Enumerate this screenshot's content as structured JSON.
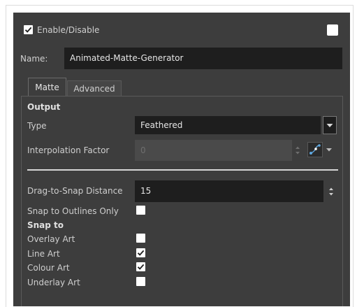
{
  "enable": {
    "label": "Enable/Disable",
    "checked": true
  },
  "name": {
    "label": "Name:",
    "value": "Animated-Matte-Generator"
  },
  "tabs": [
    {
      "label": "Matte",
      "active": true
    },
    {
      "label": "Advanced",
      "active": false
    }
  ],
  "output": {
    "heading": "Output",
    "type_label": "Type",
    "type_value": "Feathered",
    "interp_label": "Interpolation Factor",
    "interp_value": "0"
  },
  "snap": {
    "distance_label": "Drag-to-Snap Distance",
    "distance_value": "15",
    "outlines_only_label": "Snap to Outlines Only",
    "outlines_only_checked": false,
    "heading": "Snap to",
    "items": [
      {
        "label": "Overlay Art",
        "checked": false
      },
      {
        "label": "Line Art",
        "checked": true
      },
      {
        "label": "Colour Art",
        "checked": true
      },
      {
        "label": "Underlay Art",
        "checked": false
      }
    ]
  },
  "colors": {
    "panel_bg": "#3d3d3d",
    "field_bg": "#1e1e1e",
    "disabled_field_bg": "#4a4a4a",
    "text": "#cfcfcf",
    "checkbox": "#ffffff"
  },
  "icons": {
    "dropdown": "chevron-down-icon",
    "spinner": "up-down-arrows-icon",
    "curve": "function-curve-icon",
    "check": "checkmark-icon"
  }
}
